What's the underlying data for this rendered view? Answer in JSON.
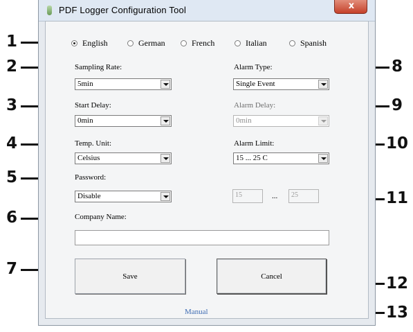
{
  "window": {
    "title": "PDF Logger Configuration Tool",
    "close_label": "x"
  },
  "languages": [
    {
      "label": "English",
      "selected": true
    },
    {
      "label": "German",
      "selected": false
    },
    {
      "label": "French",
      "selected": false
    },
    {
      "label": "Italian",
      "selected": false
    },
    {
      "label": "Spanish",
      "selected": false
    }
  ],
  "fields": {
    "sampling_rate": {
      "label": "Sampling Rate:",
      "value": "5min"
    },
    "start_delay": {
      "label": "Start Delay:",
      "value": "0min"
    },
    "temp_unit": {
      "label": "Temp. Unit:",
      "value": "Celsius"
    },
    "password": {
      "label": "Password:",
      "value": "Disable"
    },
    "company_name": {
      "label": "Company Name:",
      "value": ""
    },
    "alarm_type": {
      "label": "Alarm Type:",
      "value": "Single Event"
    },
    "alarm_delay": {
      "label": "Alarm Delay:",
      "value": "0min",
      "disabled": true
    },
    "alarm_limit": {
      "label": "Alarm Limit:",
      "value": "15 ... 25  C"
    },
    "alarm_limit_range": {
      "low": "15",
      "separator": "...",
      "high": "25",
      "disabled": true
    }
  },
  "buttons": {
    "save": "Save",
    "cancel": "Cancel"
  },
  "links": {
    "manual": "Manual"
  },
  "callouts": [
    "1",
    "2",
    "3",
    "4",
    "5",
    "6",
    "7",
    "8",
    "9",
    "10",
    "11",
    "12",
    "13"
  ]
}
